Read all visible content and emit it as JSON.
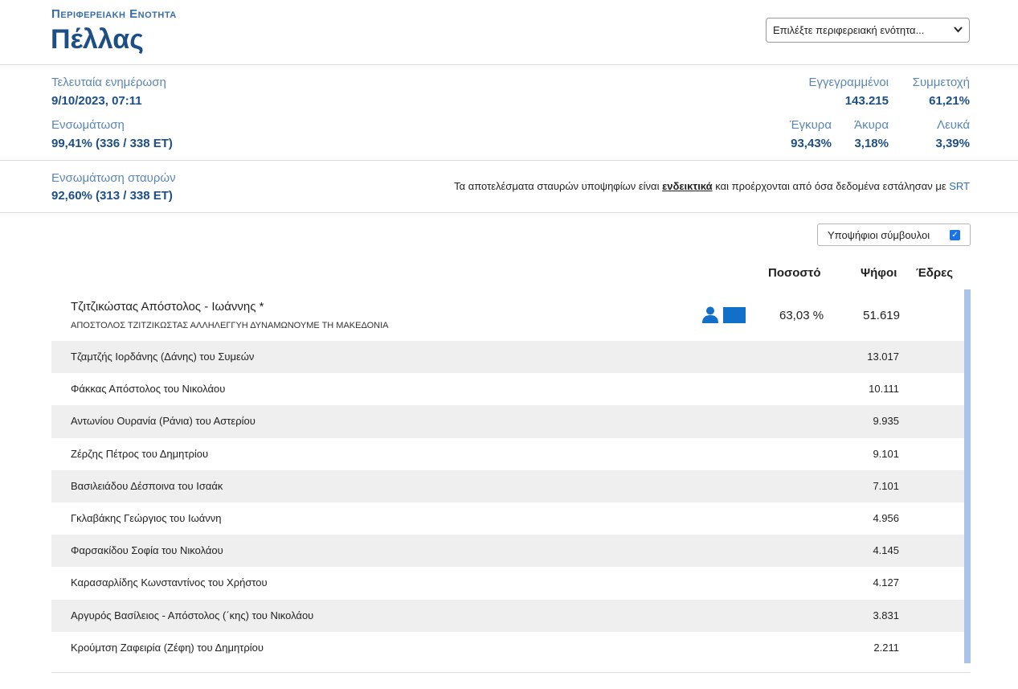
{
  "header": {
    "supertitle": "Περιφερειακη Ενοτητα",
    "title": "Πέλλας",
    "select_label": "Επιλέξτε περιφερειακή ενότητα..."
  },
  "stats": {
    "last_update_label": "Τελευταία ενημέρωση",
    "last_update_value": "9/10/2023, 07:11",
    "integration_label": "Ενσωμάτωση",
    "integration_value": "99,41% (336 / 338 ΕΤ)",
    "registered_label": "Εγγεγραμμένοι",
    "registered_value": "143.215",
    "turnout_label": "Συμμετοχή",
    "turnout_value": "61,21%",
    "valid_label": "Έγκυρα",
    "valid_value": "93,43%",
    "invalid_label": "Άκυρα",
    "invalid_value": "3,18%",
    "blank_label": "Λευκά",
    "blank_value": "3,39%"
  },
  "preferences": {
    "integration_label": "Ενσωμάτωση σταυρών",
    "integration_value": "92,60% (313 / 338 ΕΤ)",
    "note_pre": "Τα αποτελέσματα σταυρών υποψηφίων είναι ",
    "note_bold": "ενδεικτικά",
    "note_mid": " και προέρχονται από όσα δεδομένα εστάλησαν με ",
    "note_link": "SRT"
  },
  "toggle": {
    "label": "Υποψήφιοι σύμβουλοι",
    "checked": true
  },
  "columns": {
    "percent": "Ποσοστό",
    "votes": "Ψήφοι",
    "seats": "Έδρες"
  },
  "lead": {
    "name": "Τζιτζικώστας Απόστολος - Ιωάννης *",
    "party": "ΑΠΟΣΤΟΛΟΣ ΤΖΙΤΖΙΚΩΣΤΑΣ ΑΛΛΗΛΕΓΓΥΗ ΔΥΝΑΜΩΝΟΥΜΕ ΤΗ ΜΑΚΕΔΟΝΙΑ",
    "percent": "63,03 %",
    "votes": "51.619",
    "color": "#1270c9",
    "icon": "person-icon"
  },
  "candidates": [
    {
      "name": "Τζαμτζής Ιορδάνης (Δάνης) του Συμεών",
      "votes": "13.017"
    },
    {
      "name": "Φάκκας Απόστολος του Νικολάου",
      "votes": "10.111"
    },
    {
      "name": "Αντωνίου Ουρανία (Ράνια) του Αστερίου",
      "votes": "9.935"
    },
    {
      "name": "Ζέρζης Πέτρος του Δημητρίου",
      "votes": "9.101"
    },
    {
      "name": "Βασιλειάδου Δέσποινα του Ισαάκ",
      "votes": "7.101"
    },
    {
      "name": "Γκλαβάκης Γεώργιος του Ιωάννη",
      "votes": "4.956"
    },
    {
      "name": "Φαρσακίδου Σοφία του Νικολάου",
      "votes": "4.145"
    },
    {
      "name": "Καρασαρλίδης Κωνσταντίνος του Χρήστου",
      "votes": "4.127"
    },
    {
      "name": "Αργυρός Βασίλειος - Απόστολος (΄κης) του Νικολάου",
      "votes": "3.831"
    },
    {
      "name": "Κρούμτση Ζαφειρία (Ζέφη) του Δημητρίου",
      "votes": "2.211"
    }
  ]
}
